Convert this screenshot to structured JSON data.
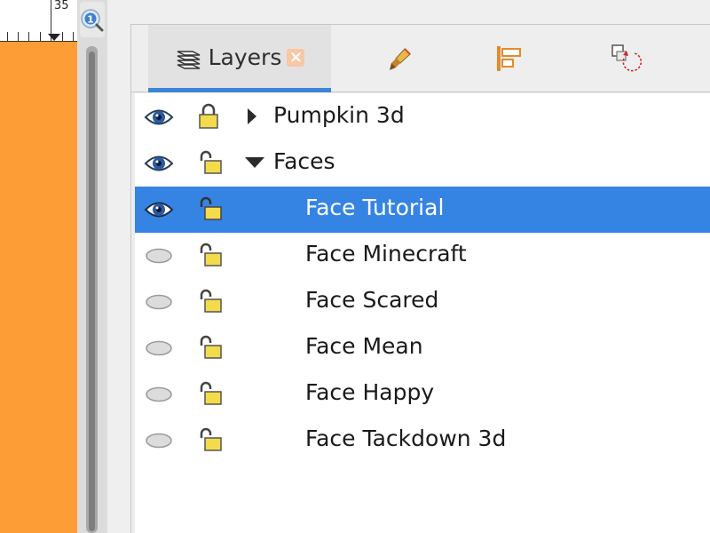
{
  "ruler": {
    "value": "35"
  },
  "canvas": {
    "background": "#fd9d36"
  },
  "zoom_button": {
    "icon": "zoom-correction-icon"
  },
  "dock": {
    "tabs": [
      {
        "label": "Layers",
        "icon": "layers-icon",
        "close_icon": "close-icon",
        "active": true
      },
      {
        "label": "",
        "icon": "fill-stroke-brush-icon",
        "active": false
      },
      {
        "label": "",
        "icon": "align-distribute-icon",
        "active": false
      },
      {
        "label": "",
        "icon": "transform-rotate-icon",
        "active": false
      }
    ],
    "accent_color": "#3a86d6"
  },
  "layers": {
    "selection_color": "#3584e4",
    "rows": [
      {
        "name": "Pumpkin 3d",
        "visible": true,
        "locked": true,
        "expander": "collapsed"
      },
      {
        "name": "Faces",
        "visible": true,
        "locked": false,
        "expander": "expanded"
      },
      {
        "name": "Face Tutorial",
        "visible": true,
        "locked": false,
        "selected": true
      },
      {
        "name": "Face Minecraft",
        "visible": false,
        "locked": false
      },
      {
        "name": "Face Scared",
        "visible": false,
        "locked": false
      },
      {
        "name": "Face Mean",
        "visible": false,
        "locked": false
      },
      {
        "name": "Face Happy",
        "visible": false,
        "locked": false
      },
      {
        "name": "Face Tackdown 3d",
        "visible": false,
        "locked": false
      }
    ]
  }
}
